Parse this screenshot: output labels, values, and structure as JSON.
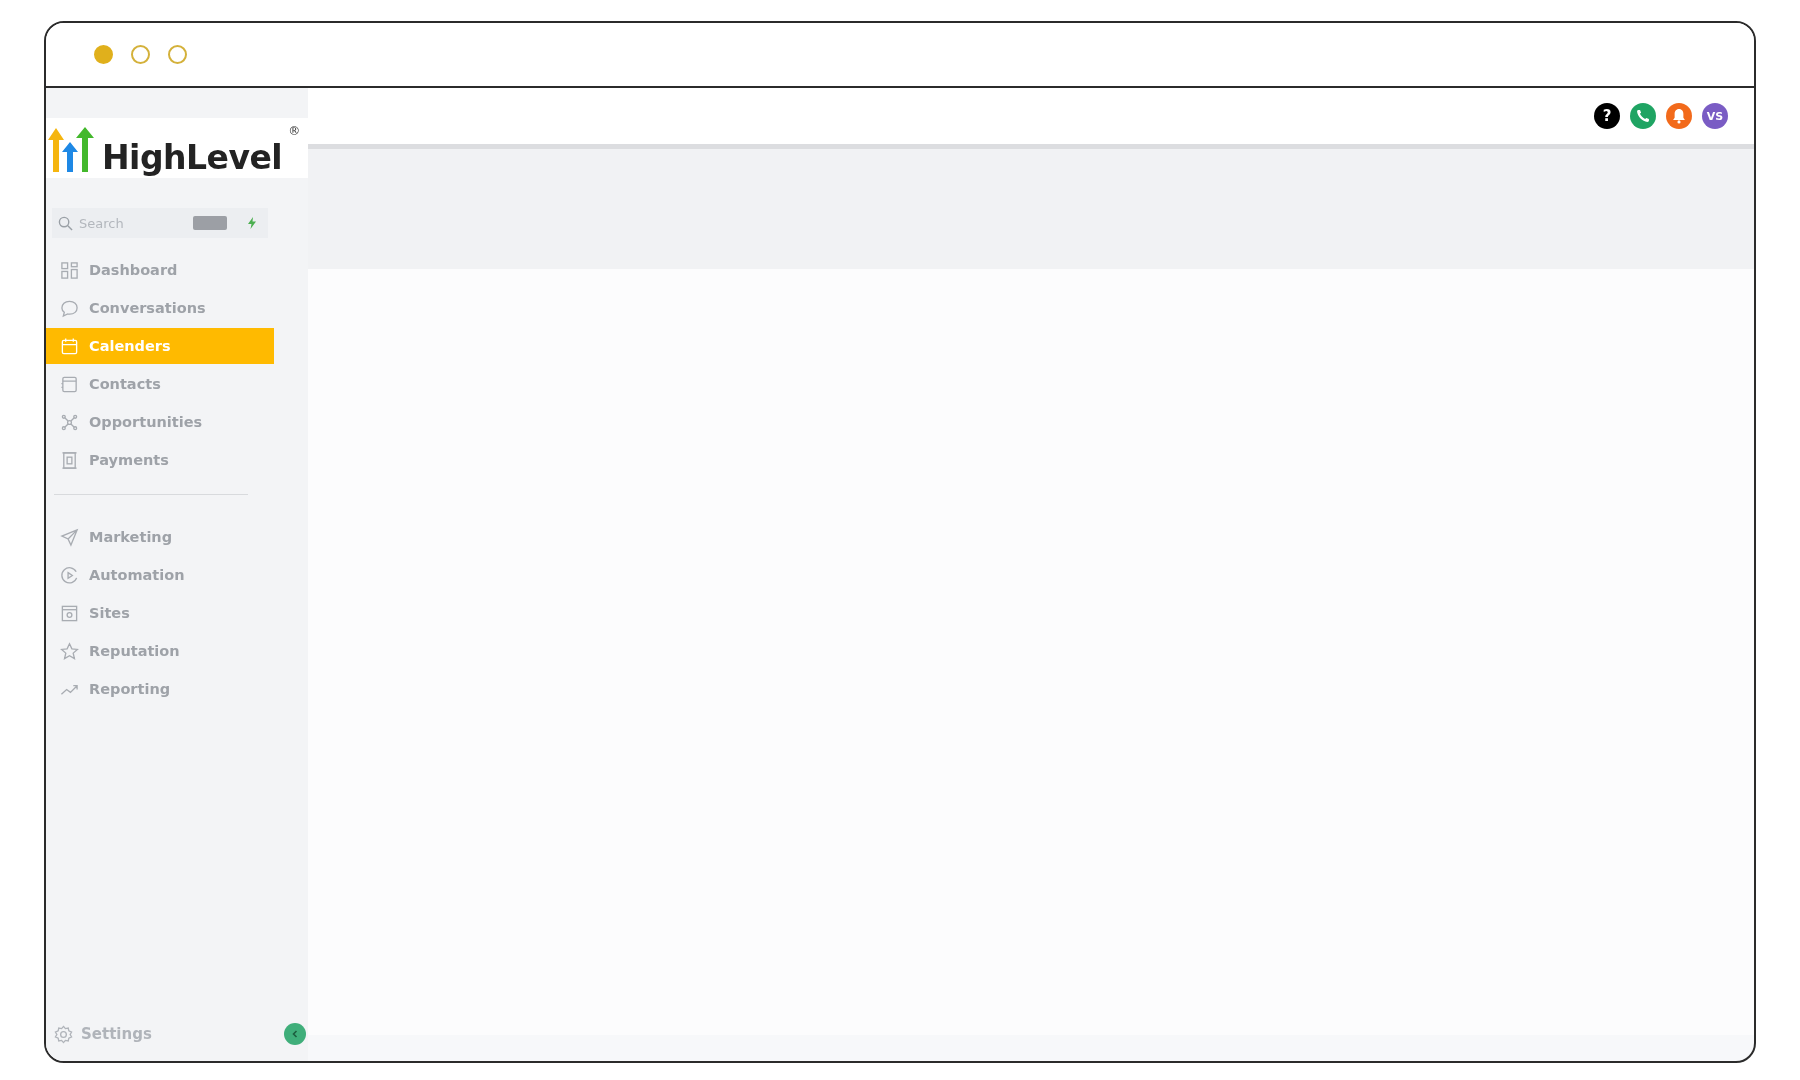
{
  "logo": {
    "text": "HighLevel",
    "mark": "®"
  },
  "sidebar": {
    "search": {
      "placeholder": "Search"
    },
    "primary_items": [
      {
        "label": "Dashboard",
        "selected": false
      },
      {
        "label": "Conversations",
        "selected": false
      },
      {
        "label": "Calenders",
        "selected": true
      },
      {
        "label": "Contacts",
        "selected": false
      },
      {
        "label": "Opportunities",
        "selected": false
      },
      {
        "label": "Payments",
        "selected": false
      }
    ],
    "secondary_items": [
      {
        "label": "Marketing",
        "selected": false
      },
      {
        "label": "Automation",
        "selected": false
      },
      {
        "label": "Sites",
        "selected": false
      },
      {
        "label": "Reputation",
        "selected": false
      },
      {
        "label": "Reporting",
        "selected": false
      }
    ],
    "settings": "Settings"
  },
  "header": {
    "help": "?",
    "avatar_initials": "VS"
  }
}
